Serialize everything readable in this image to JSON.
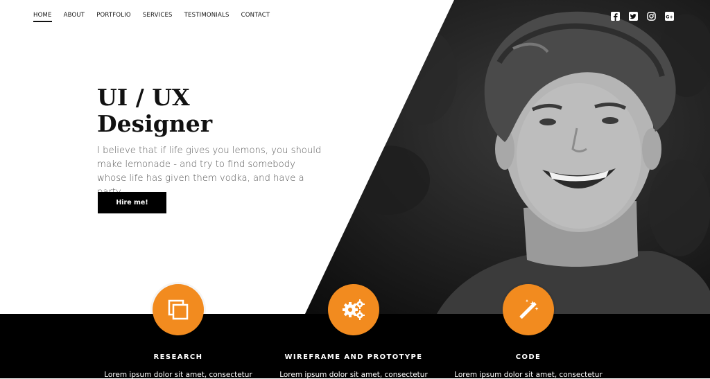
{
  "nav": {
    "items": [
      {
        "label": "HOME"
      },
      {
        "label": "ABOUT"
      },
      {
        "label": "PORTFOLIO"
      },
      {
        "label": "SERVICES"
      },
      {
        "label": "TESTIMONIALS"
      },
      {
        "label": "CONTACT"
      }
    ],
    "active_index": 0
  },
  "social_icons": [
    "facebook-icon",
    "twitter-icon",
    "instagram-icon",
    "google-plus-icon"
  ],
  "hero": {
    "title_line1": "UI / UX",
    "title_line2": "Designer",
    "description": "I believe that if life gives you lemons, you should make lemonade - and try to find somebody whose life has given them vodka, and have a party.",
    "button_label": "Hire me!"
  },
  "features": [
    {
      "icon": "layers-icon",
      "title": "RESEARCH",
      "text": "Lorem ipsum dolor sit amet, consectetur"
    },
    {
      "icon": "gears-icon",
      "title": "WIREFRAME AND PROTOTYPE",
      "text": "Lorem ipsum dolor sit amet, consectetur"
    },
    {
      "icon": "magic-wand-icon",
      "title": "CODE",
      "text": "Lorem ipsum dolor sit amet, consectetur"
    }
  ],
  "colors": {
    "accent": "#f28b1f",
    "dark": "#000000",
    "text": "#111111",
    "muted": "#555555"
  }
}
